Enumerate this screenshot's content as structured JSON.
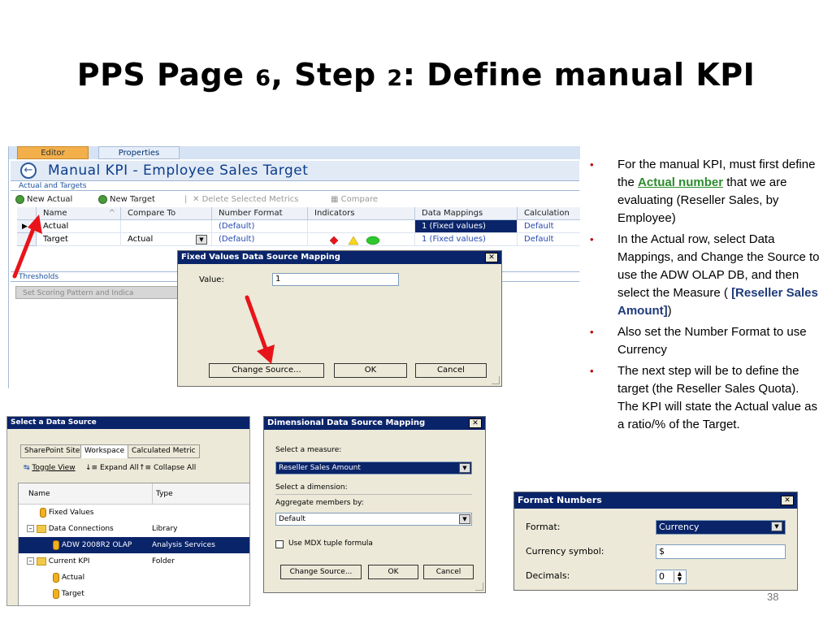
{
  "slide": {
    "title_a": "PPS Page ",
    "title_num1": "6",
    "title_b": ", Step ",
    "title_num2": "2",
    "title_c": ": Define manual KPI",
    "page_number": "38"
  },
  "editor": {
    "tabs": [
      "Editor",
      "Properties"
    ],
    "kpi_title": "Manual KPI - Employee Sales Target",
    "section_actual_targets": "Actual and Targets",
    "toolbar": {
      "new_actual": "New Actual",
      "new_target": "New Target",
      "delete_selected": "Delete Selected Metrics",
      "compare": "Compare"
    },
    "columns": [
      "Name",
      "Compare To",
      "Number Format",
      "Indicators",
      "Data Mappings",
      "Calculation"
    ],
    "rows": [
      {
        "name": "Actual",
        "compare_to": "",
        "number_format": "(Default)",
        "data_mappings": "1 (Fixed values)",
        "calculation": "Default"
      },
      {
        "name": "Target",
        "compare_to": "Actual",
        "number_format": "(Default)",
        "data_mappings": "1 (Fixed values)",
        "calculation": "Default"
      }
    ],
    "section_thresholds": "Thresholds",
    "set_scoring": "Set Scoring Pattern and Indica"
  },
  "fixed_values_dialog": {
    "title": "Fixed Values Data Source Mapping",
    "value_label": "Value:",
    "value": "1",
    "change_source": "Change Source...",
    "ok": "OK",
    "cancel": "Cancel"
  },
  "select_data_source": {
    "title": "Select a Data Source",
    "tabs": [
      "SharePoint Site",
      "Workspace",
      "Calculated Metric"
    ],
    "toggle_view": "Toggle View",
    "expand_all": "Expand All",
    "collapse_all": "Collapse All",
    "col_name": "Name",
    "col_type": "Type",
    "rows": [
      {
        "name": "Fixed Values",
        "type": ""
      },
      {
        "name": "Data Connections",
        "type": "Library"
      },
      {
        "name": "ADW 2008R2 OLAP",
        "type": "Analysis Services"
      },
      {
        "name": "Current KPI",
        "type": "Folder"
      },
      {
        "name": "Actual",
        "type": ""
      },
      {
        "name": "Target",
        "type": ""
      }
    ]
  },
  "dimensional_dialog": {
    "title": "Dimensional Data Source Mapping",
    "select_measure": "Select a measure:",
    "measure_value": "Reseller Sales Amount",
    "select_dimension": "Select a dimension:",
    "aggregate_label": "Aggregate members by:",
    "aggregate_value": "Default",
    "use_mdx": "Use MDX tuple formula",
    "change_source": "Change Source...",
    "ok": "OK",
    "cancel": "Cancel"
  },
  "bullets": {
    "b1_pre": "For the manual KPI, must first define the ",
    "b1_link": "Actual number",
    "b1_post": " that we are evaluating (Reseller Sales, by Employee)",
    "b2_pre": "In the Actual row, select Data Mappings, and Change the Source to use the ADW OLAP DB, and then select the Measure ( ",
    "b2_bold": "[Reseller Sales Amount]",
    "b2_post": ")",
    "b3": "Also set the Number Format to use Currency",
    "b4": "The next step will be to define the target (the Reseller Sales Quota).  The KPI will state the Actual value as a ratio/% of the Target."
  },
  "format_numbers": {
    "title": "Format Numbers",
    "format_label": "Format:",
    "format_value": "Currency",
    "currency_label": "Currency symbol:",
    "currency_value": "$",
    "decimals_label": "Decimals:",
    "decimals_value": "0"
  },
  "colors": {
    "arrow_red": "#e8141a",
    "link_green": "#2e8b2e",
    "selection_navy": "#0a246a"
  }
}
